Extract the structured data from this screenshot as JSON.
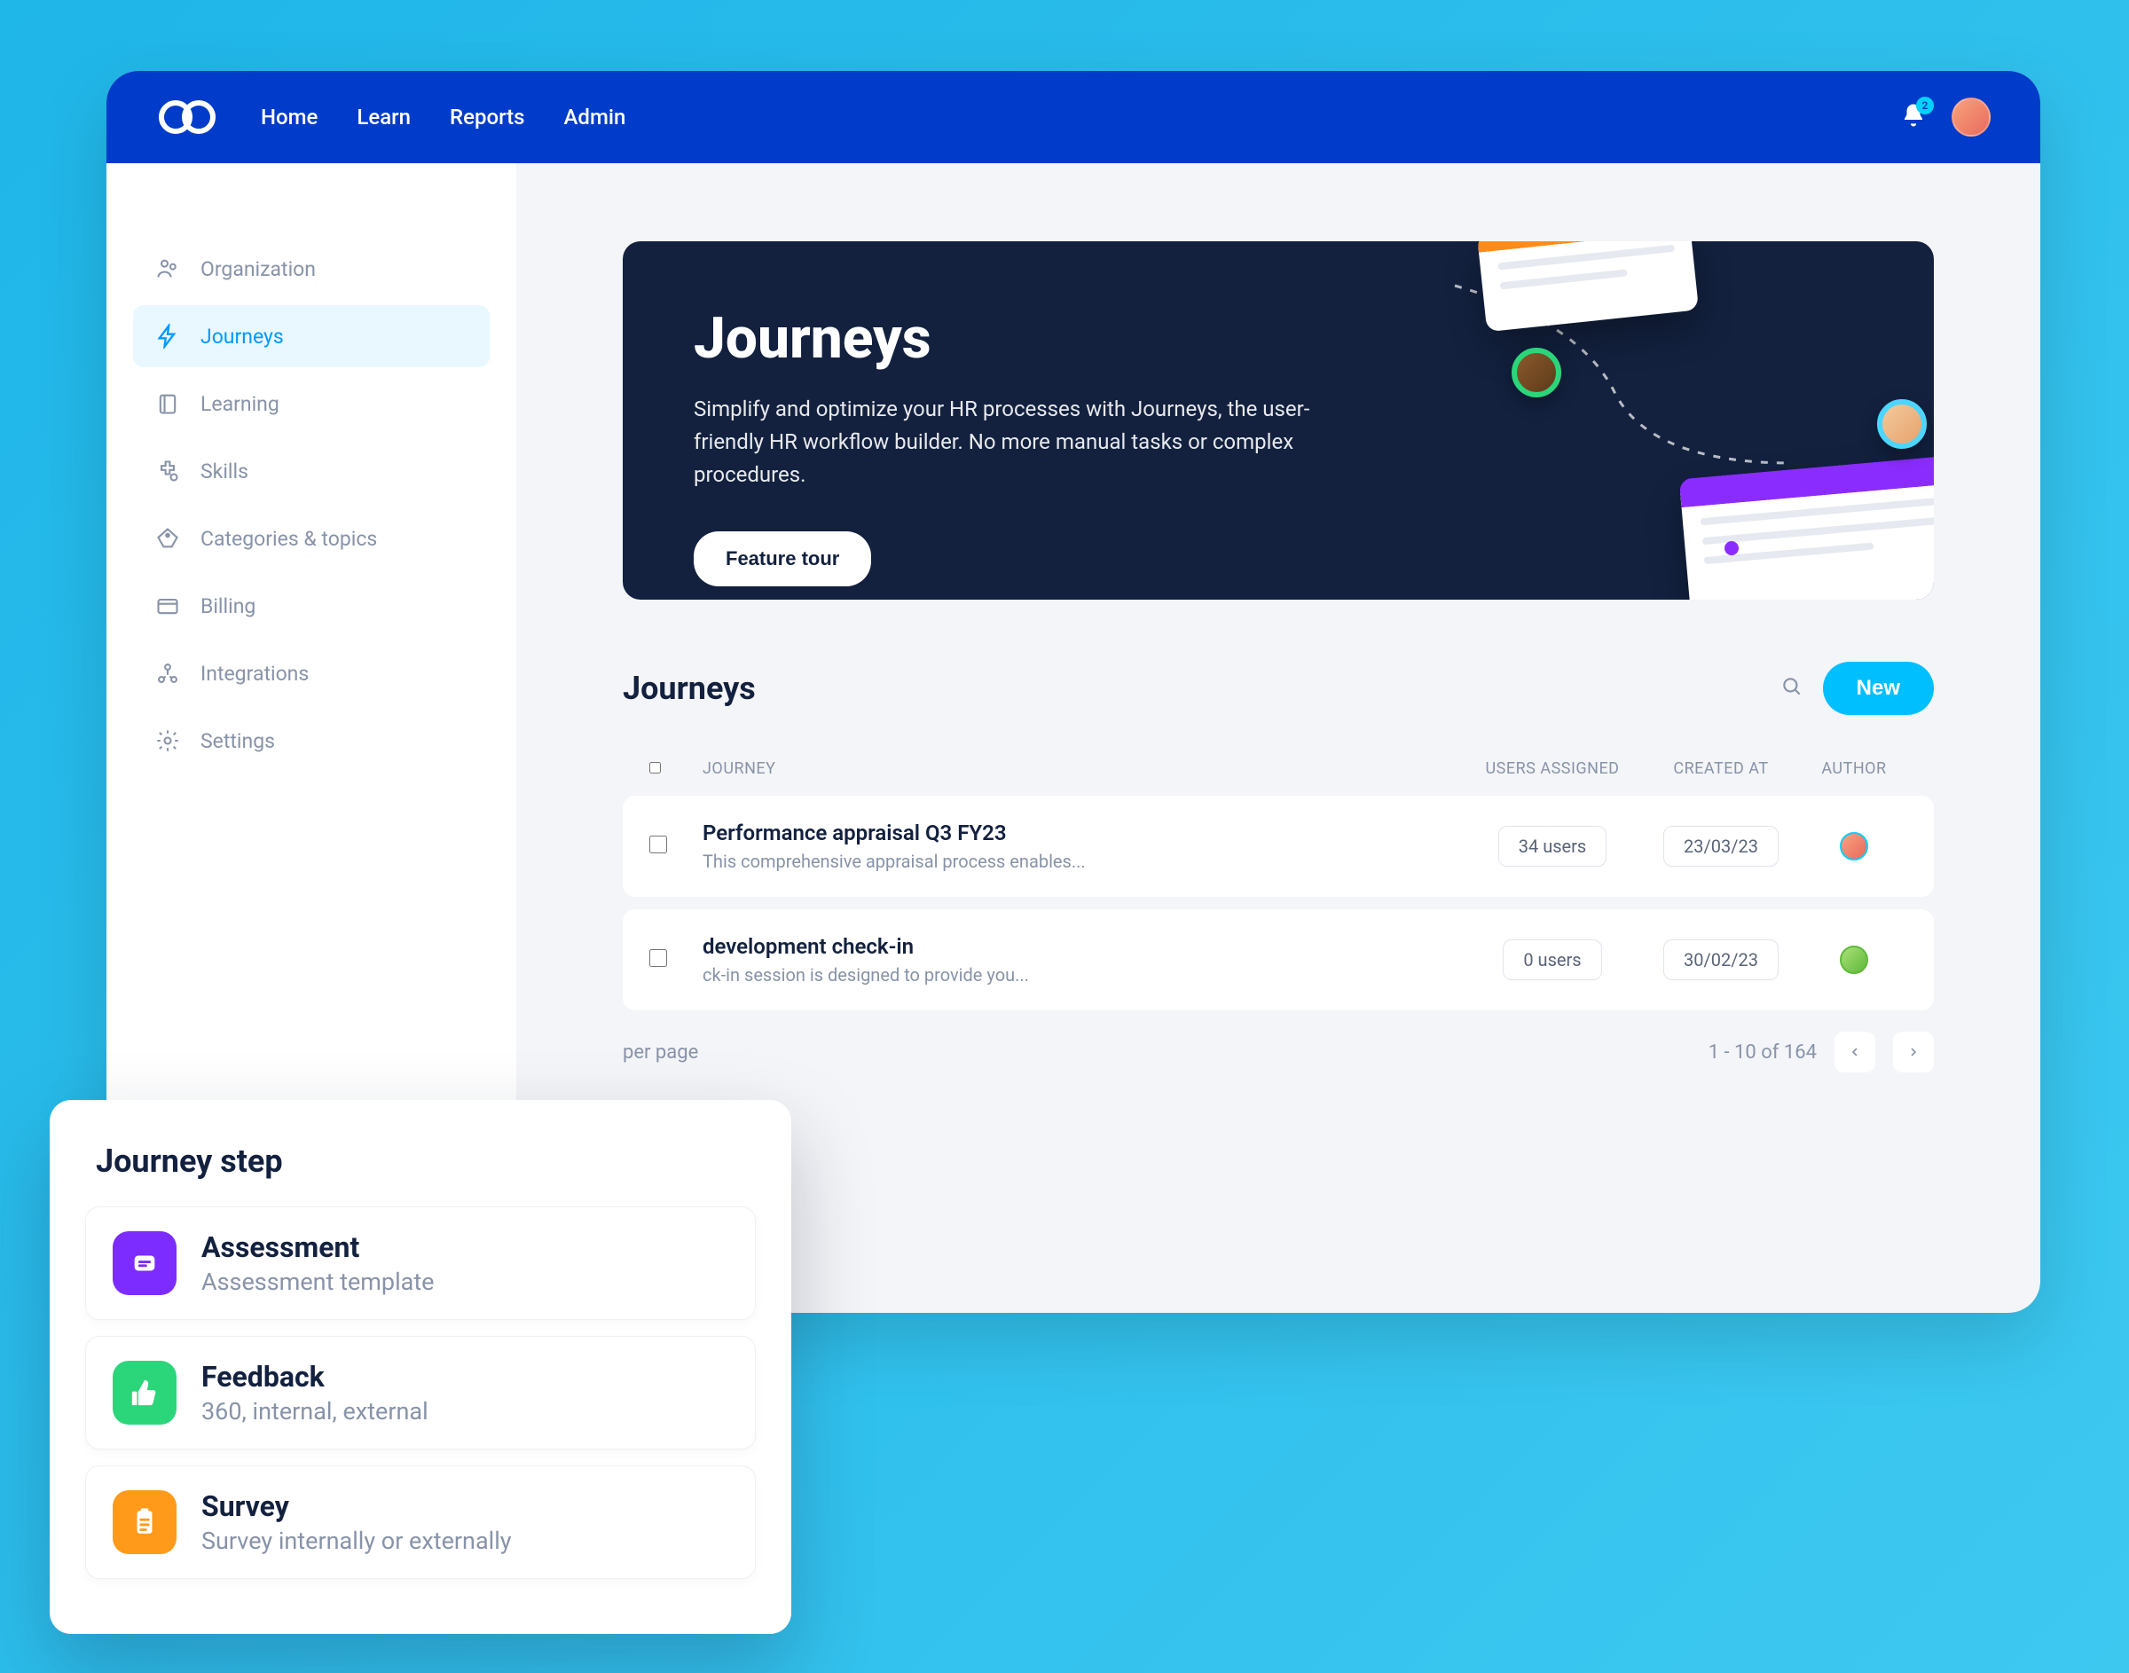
{
  "nav": {
    "home": "Home",
    "learn": "Learn",
    "reports": "Reports",
    "admin": "Admin"
  },
  "badge_count": "2",
  "sidebar": {
    "items": [
      {
        "label": "Organization"
      },
      {
        "label": "Journeys"
      },
      {
        "label": "Learning"
      },
      {
        "label": "Skills"
      },
      {
        "label": "Categories & topics"
      },
      {
        "label": "Billing"
      },
      {
        "label": "Integrations"
      },
      {
        "label": "Settings"
      }
    ]
  },
  "hero": {
    "title": "Journeys",
    "subtitle": "Simplify and optimize your HR processes with Journeys, the user-friendly HR workflow builder. No more manual tasks or complex procedures.",
    "cta": "Feature tour"
  },
  "section": {
    "title": "Journeys",
    "new_btn": "New"
  },
  "table": {
    "headers": {
      "journey": "JOURNEY",
      "users": "USERS ASSIGNED",
      "created": "CREATED AT",
      "author": "AUTHOR"
    },
    "rows": [
      {
        "title": "Performance appraisal Q3 FY23",
        "subtitle": "This comprehensive appraisal process enables...",
        "users": "34 users",
        "created": "23/03/23"
      },
      {
        "title": "development check-in",
        "subtitle": "ck-in session is designed to provide you...",
        "users": "0 users",
        "created": "30/02/23"
      }
    ]
  },
  "pager": {
    "per_page": "per page",
    "range": "1 - 10 of 164"
  },
  "overlay": {
    "title": "Journey step",
    "steps": [
      {
        "title": "Assessment",
        "subtitle": "Assessment template"
      },
      {
        "title": "Feedback",
        "subtitle": "360, internal, external"
      },
      {
        "title": "Survey",
        "subtitle": "Survey internally or externally"
      }
    ]
  }
}
